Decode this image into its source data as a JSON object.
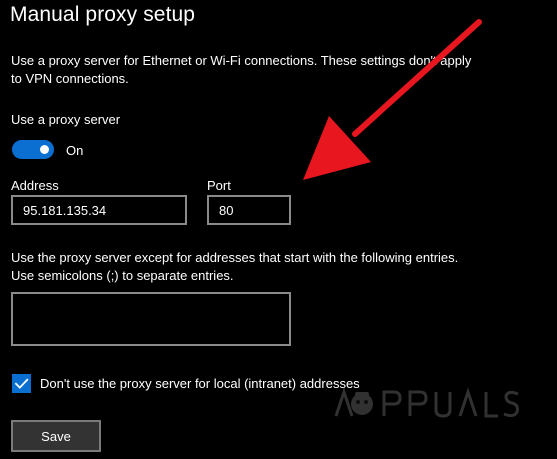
{
  "title": "Manual proxy setup",
  "description": "Use a proxy server for Ethernet or Wi-Fi connections. These settings don't apply to VPN connections.",
  "proxy_toggle": {
    "label": "Use a proxy server",
    "state_text": "On",
    "on": true
  },
  "address": {
    "label": "Address",
    "value": "95.181.135.34"
  },
  "port": {
    "label": "Port",
    "value": "80"
  },
  "exceptions": {
    "label": "Use the proxy server except for addresses that start with the following entries. Use semicolons (;) to separate entries.",
    "value": ""
  },
  "local_bypass": {
    "checked": true,
    "label": "Don't use the proxy server for local (intranet) addresses"
  },
  "save_label": "Save",
  "watermark": "APPUALS",
  "colors": {
    "background": "#000000",
    "accent": "#0a6fd0",
    "arrow": "#e8171f",
    "field_border": "#8a8a8a",
    "button_bg": "#333333"
  },
  "icons": {
    "checkbox": "checkmark-icon",
    "annotation": "red-arrow-icon"
  }
}
